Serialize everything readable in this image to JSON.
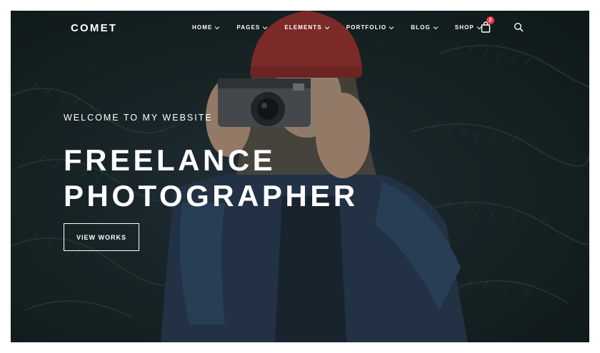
{
  "brand": {
    "logo_text": "COMET"
  },
  "nav": {
    "items": [
      {
        "label": "HOME"
      },
      {
        "label": "PAGES"
      },
      {
        "label": "ELEMENTS"
      },
      {
        "label": "PORTFOLIO"
      },
      {
        "label": "BLOG"
      },
      {
        "label": "SHOP"
      }
    ],
    "cart_count": "2",
    "cart_icon": "shopping-bag-icon",
    "search_icon": "search-icon"
  },
  "hero": {
    "eyebrow": "WELCOME TO MY WEBSITE",
    "headline_line1": "FREELANCE",
    "headline_line2": "PHOTOGRAPHER",
    "cta_label": "VIEW WORKS"
  },
  "colors": {
    "badge": "#e8374f",
    "text": "#ffffff",
    "background": "#1c2a2c"
  }
}
